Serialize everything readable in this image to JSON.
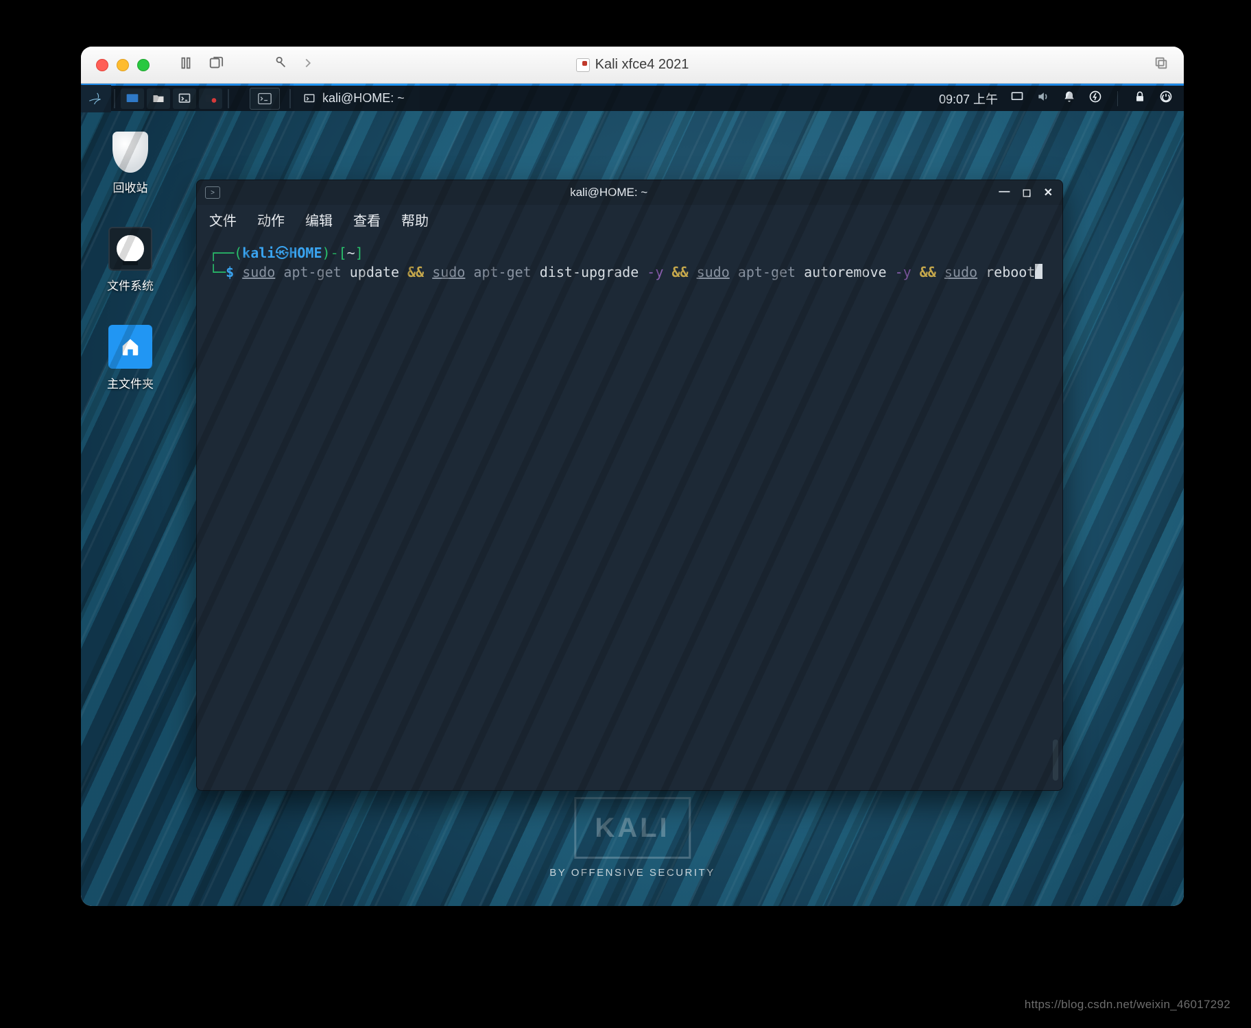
{
  "mac": {
    "title": "Kali xfce4 2021"
  },
  "kali_panel": {
    "task_title": "kali@HOME: ~",
    "clock": "09:07 上午"
  },
  "desktop_icons": {
    "trash": "回收站",
    "filesystem": "文件系统",
    "home": "主文件夹"
  },
  "branding": {
    "name": "KALI",
    "tagline": "BY OFFENSIVE SECURITY"
  },
  "terminal": {
    "title": "kali@HOME: ~",
    "menu": {
      "file": "文件",
      "actions": "动作",
      "edit": "编辑",
      "view": "查看",
      "help": "帮助"
    },
    "prompt": {
      "user": "kali",
      "host": "HOME",
      "path": "~",
      "symbol": "$"
    },
    "command": {
      "sudo1": "sudo",
      "c1a": "apt-get",
      "c1b": "update",
      "op1": "&&",
      "sudo2": "sudo",
      "c2a": "apt-get",
      "c2b": "dist-upgrade",
      "f1": "-y",
      "op2": "&&",
      "sudo3": "sudo",
      "c3a": "apt-get",
      "c3b": "autoremove",
      "f2": "-y",
      "op3": "&&",
      "sudo4": "sudo",
      "c4": "reboot"
    }
  },
  "watermark": "https://blog.csdn.net/weixin_46017292"
}
